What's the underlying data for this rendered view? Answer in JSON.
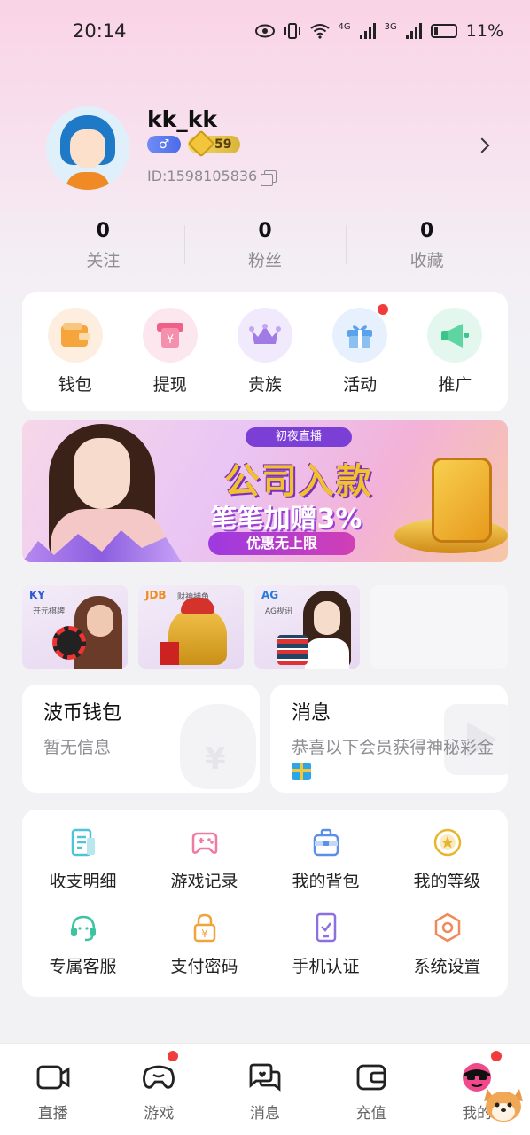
{
  "status_bar": {
    "time": "20:14",
    "net1": "4G",
    "net2": "3G",
    "battery": "11%"
  },
  "profile": {
    "username": "kk_kk",
    "gender_symbol": "♂",
    "level": "59",
    "user_id": "ID:1598105836"
  },
  "stats": [
    {
      "value": "0",
      "label": "关注"
    },
    {
      "value": "0",
      "label": "粉丝"
    },
    {
      "value": "0",
      "label": "收藏"
    }
  ],
  "quick_actions": [
    {
      "label": "钱包",
      "icon": "wallet-icon",
      "color": "#f6a53c",
      "bg": "#fdeee0"
    },
    {
      "label": "提现",
      "icon": "withdraw-icon",
      "color": "#f0618a",
      "bg": "#fde7ef"
    },
    {
      "label": "贵族",
      "icon": "crown-icon",
      "color": "#a07be6",
      "bg": "#f1eafc"
    },
    {
      "label": "活动",
      "icon": "gift-icon",
      "color": "#5aa3ec",
      "bg": "#e7f1fd",
      "badge": true
    },
    {
      "label": "推广",
      "icon": "megaphone-icon",
      "color": "#3cc58a",
      "bg": "#e3f7ee"
    }
  ],
  "banner": {
    "small_text": "初夜直播",
    "title": "公司入款",
    "subtitle": "笔笔加赠3%",
    "pill": "优惠无上限"
  },
  "games": [
    {
      "tag": "KY",
      "sub": "开元棋牌"
    },
    {
      "tag": "JDB",
      "sub": "财神捕鱼"
    },
    {
      "tag": "AG",
      "sub": "AG视讯"
    }
  ],
  "wallet_card": {
    "title": "波币钱包",
    "text": "暂无信息"
  },
  "message_card": {
    "title": "消息",
    "text": "恭喜以下会员获得神秘彩金"
  },
  "tools": [
    {
      "label": "收支明细",
      "icon": "bill-detail-icon",
      "color": "#4fc3d8"
    },
    {
      "label": "游戏记录",
      "icon": "gamepad-icon",
      "color": "#f07aa0"
    },
    {
      "label": "我的背包",
      "icon": "backpack-icon",
      "color": "#5b8fe8"
    },
    {
      "label": "我的等级",
      "icon": "level-star-icon",
      "color": "#e8b52c"
    },
    {
      "label": "专属客服",
      "icon": "headset-icon",
      "color": "#3cc3a0"
    },
    {
      "label": "支付密码",
      "icon": "lock-icon",
      "color": "#f0a43c"
    },
    {
      "label": "手机认证",
      "icon": "phone-check-icon",
      "color": "#8c6fe0"
    },
    {
      "label": "系统设置",
      "icon": "settings-hex-icon",
      "color": "#f08a5a"
    }
  ],
  "bottom_nav": [
    {
      "label": "直播",
      "icon": "live-camera-icon"
    },
    {
      "label": "游戏",
      "icon": "game-controller-icon",
      "badge": true
    },
    {
      "label": "消息",
      "icon": "chat-bubbles-icon"
    },
    {
      "label": "充值",
      "icon": "wallet-recharge-icon"
    },
    {
      "label": "我的",
      "icon": "profile-avatar-icon",
      "badge": true
    }
  ],
  "colors": {
    "accent_red": "#f23b3b",
    "badge_blue": "#4c6be8",
    "level_gold": "#d9b43a"
  }
}
